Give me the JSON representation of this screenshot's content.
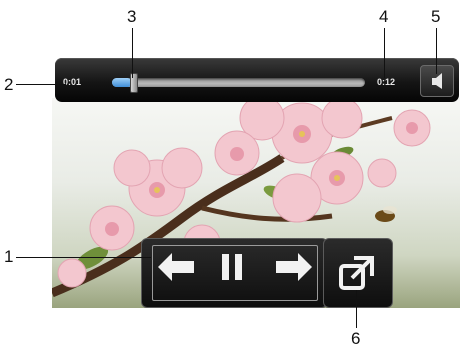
{
  "player": {
    "elapsed_time": "0:01",
    "total_time": "0:12",
    "progress_fraction": 0.08
  },
  "callouts": {
    "c1": "1",
    "c2": "2",
    "c3": "3",
    "c4": "4",
    "c5": "5",
    "c6": "6"
  },
  "icons": {
    "volume": "speaker-icon",
    "previous": "arrow-left-icon",
    "pause": "pause-icon",
    "next": "arrow-right-icon",
    "fullscreen": "fullscreen-toggle-icon"
  },
  "colors": {
    "progress_fill": "#3f8ed8",
    "bar_background": "#151515"
  }
}
